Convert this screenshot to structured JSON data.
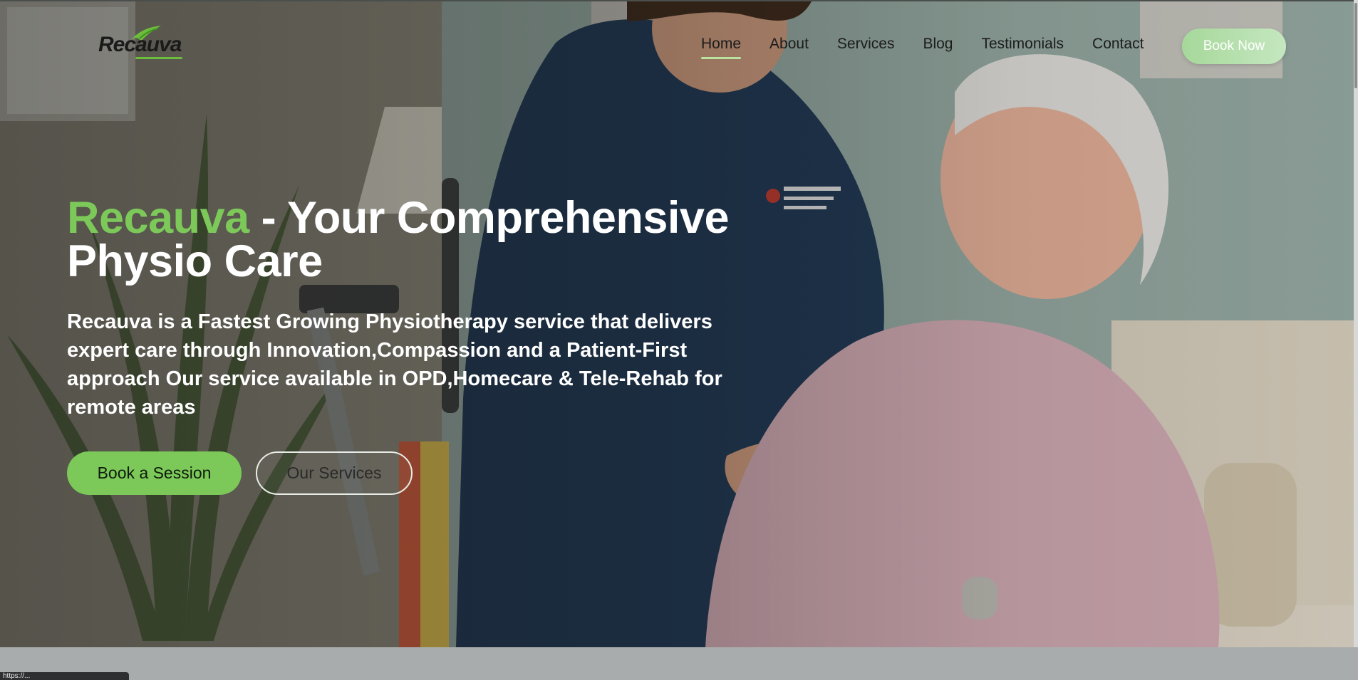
{
  "logo": {
    "text": "Recauva"
  },
  "nav": {
    "items": [
      {
        "label": "Home",
        "active": true
      },
      {
        "label": "About",
        "active": false
      },
      {
        "label": "Services",
        "active": false
      },
      {
        "label": "Blog",
        "active": false
      },
      {
        "label": "Testimonials",
        "active": false
      },
      {
        "label": "Contact",
        "active": false
      }
    ],
    "book_now": "Book Now"
  },
  "hero": {
    "title_brand": "Recauva",
    "title_rest": " - Your Comprehensive Physio Care",
    "lead": "Recauva is a Fastest Growing Physiotherapy service that delivers expert care through Innovation,Compassion and a Patient-First approach Our service available in OPD,Homecare & Tele-Rehab for remote areas",
    "primary_button": "Book a Session",
    "secondary_button": "Our Services"
  },
  "status_bar": {
    "url": "https://..."
  },
  "colors": {
    "accent_green": "#7cc95a",
    "book_now_gradient_start": "#a6d89a",
    "text_dark": "#1c1c1c",
    "text_light": "#ffffff"
  },
  "icons": {
    "logo_mark": "leaf-swoosh-icon"
  }
}
